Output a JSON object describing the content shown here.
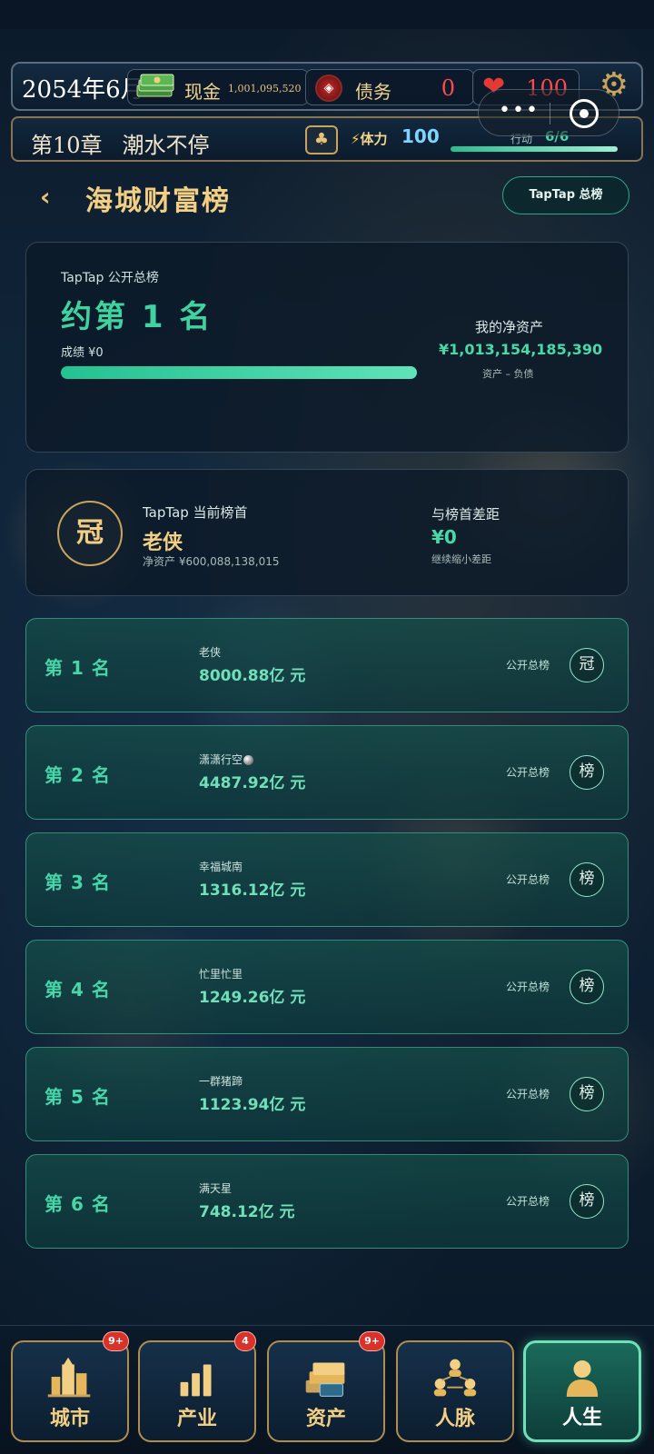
{
  "hud": {
    "date": "2054年6月",
    "cash_label": "现金",
    "cash_value": "1,001,095,520",
    "debt_label": "债务",
    "debt_value": "0",
    "hp_value": "100",
    "chapter": "第10章",
    "chapter_title": "潮水不停",
    "stamina_label": "体力",
    "stamina_value": "100",
    "action_label": "行动",
    "action_value": "6/6"
  },
  "page": {
    "title": "海城财富榜",
    "board_button": "TapTap 总榜"
  },
  "summary": {
    "caption": "TapTap 公开总榜",
    "rank": "约第 1 名",
    "score": "成绩 ¥0",
    "progress": 1.0,
    "networth_label": "我的净资产",
    "networth_value": "¥1,013,154,185,390",
    "networth_note": "资产 – 负债"
  },
  "leader": {
    "crown": "冠",
    "caption": "TapTap 当前榜首",
    "name": "老侠",
    "networth": "净资产 ¥600,088,138,015",
    "gap_label": "与榜首差距",
    "gap_value": "¥0",
    "gap_note": "继续缩小差距"
  },
  "rankings": [
    {
      "rank": "第 1 名",
      "name": "老侠",
      "value": "8000.88亿 元",
      "board": "公开总榜",
      "badge": "冠"
    },
    {
      "rank": "第 2 名",
      "name": "潇潇行空",
      "value": "4487.92亿 元",
      "board": "公开总榜",
      "badge": "榜"
    },
    {
      "rank": "第 3 名",
      "name": "幸福城南",
      "value": "1316.12亿 元",
      "board": "公开总榜",
      "badge": "榜"
    },
    {
      "rank": "第 4 名",
      "name": "忙里忙里",
      "value": "1249.26亿 元",
      "board": "公开总榜",
      "badge": "榜"
    },
    {
      "rank": "第 5 名",
      "name": "一群猪蹄",
      "value": "1123.94亿 元",
      "board": "公开总榜",
      "badge": "榜"
    },
    {
      "rank": "第 6 名",
      "name": "满天星",
      "value": "748.12亿 元",
      "board": "公开总榜",
      "badge": "榜"
    }
  ],
  "nav": [
    {
      "label": "城市",
      "badge": "9+",
      "icon": "city-icon"
    },
    {
      "label": "产业",
      "badge": "4",
      "icon": "bar-chart-icon"
    },
    {
      "label": "资产",
      "badge": "9+",
      "icon": "money-stack-icon"
    },
    {
      "label": "人脉",
      "badge": "",
      "icon": "network-icon"
    },
    {
      "label": "人生",
      "badge": "",
      "icon": "person-icon"
    }
  ],
  "colors": {
    "accent_green": "#47d6a9",
    "gold": "#f3cf83",
    "danger_red": "#ff4a4a"
  }
}
